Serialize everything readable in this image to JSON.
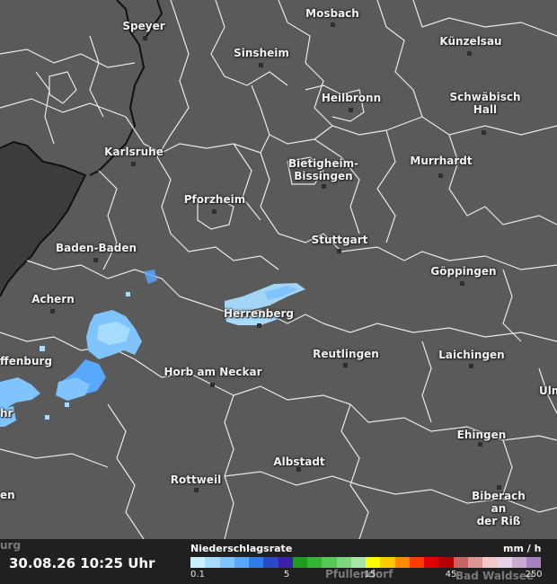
{
  "timestamp": "30.08.26 10:25 Uhr",
  "legend": {
    "title": "Niederschlagsrate",
    "unit": "mm / h",
    "ticks": [
      "0.1",
      "5",
      "15",
      "45",
      "250"
    ],
    "colors": [
      "#c8f0ff",
      "#a6dcff",
      "#7fc4ff",
      "#58a8ff",
      "#2f7ee8",
      "#2a48c8",
      "#3a1fa8",
      "#219a21",
      "#33b633",
      "#55c855",
      "#7cd67c",
      "#a6e6a6",
      "#ffff00",
      "#ffc800",
      "#ff8c00",
      "#ff3c00",
      "#e00000",
      "#b30000",
      "#c86464",
      "#dc9696",
      "#f0c8c8",
      "#e6d2e6",
      "#c8aad2",
      "#a882be"
    ]
  },
  "cities": [
    {
      "name": "Mosbach"
    },
    {
      "name": "Speyer"
    },
    {
      "name": "Sinsheim"
    },
    {
      "name": "Künzelsau"
    },
    {
      "name": "Heilbronn"
    },
    {
      "name": "Schwäbisch\nHall"
    },
    {
      "name": "Karlsruhe"
    },
    {
      "name": "Bietigheim-\nBissingen"
    },
    {
      "name": "Murrhardt"
    },
    {
      "name": "Pforzheim"
    },
    {
      "name": "Stuttgart"
    },
    {
      "name": "Baden-Baden"
    },
    {
      "name": "Göppingen"
    },
    {
      "name": "Achern"
    },
    {
      "name": "Herrenberg"
    },
    {
      "name": "ffenburg"
    },
    {
      "name": "Reutlingen"
    },
    {
      "name": "Laichingen"
    },
    {
      "name": "Horb am Neckar"
    },
    {
      "name": "Ulm"
    },
    {
      "name": "hr"
    },
    {
      "name": "Ehingen"
    },
    {
      "name": "Albstadt"
    },
    {
      "name": "en"
    },
    {
      "name": "Rottweil"
    },
    {
      "name": "Biberach an\nder Riß"
    }
  ],
  "hidden_labels": [
    "urg",
    "Pfullendorf",
    "Bad Waldsee"
  ]
}
